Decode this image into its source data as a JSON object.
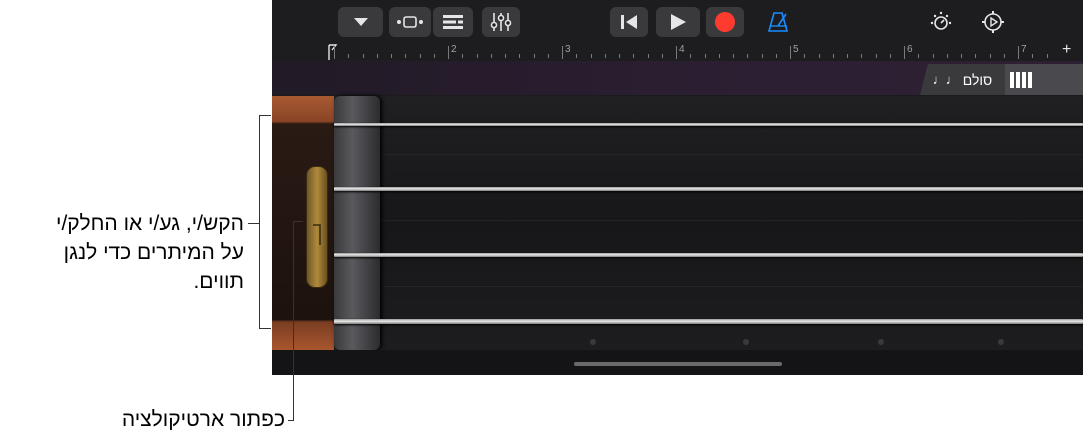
{
  "toolbar": {
    "icons": [
      "dropdown-icon",
      "view-icon",
      "tracks-icon",
      "mixer-icon",
      "rewind-icon",
      "play-icon",
      "record-icon",
      "metronome-icon",
      "master-volume-icon",
      "settings-icon"
    ],
    "colors": {
      "record": "#ff3b30",
      "metronome": "#1a8cff",
      "icon": "#e5e5ea"
    }
  },
  "ruler": {
    "bars": [
      "2",
      "3",
      "4",
      "5",
      "6",
      "7"
    ],
    "add_label": "+"
  },
  "tabs": {
    "scale_label": "סולם",
    "scale_icon": "♩♩",
    "view_icon": "chord-strips-icon"
  },
  "callouts": {
    "strings_line1": "הקש/י, גע/י או החלק/י",
    "strings_line2": "על המיתרים כדי לנגן",
    "strings_line3": "תווים.",
    "articulation": "כפתור ארטיקולציה"
  }
}
